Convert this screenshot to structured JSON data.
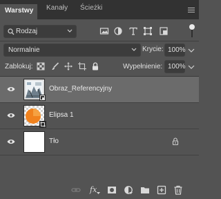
{
  "tabs": [
    {
      "label": "Warstwy",
      "active": true
    },
    {
      "label": "Kanały",
      "active": false
    },
    {
      "label": "Ścieżki",
      "active": false
    }
  ],
  "filter": {
    "kind_label": "Rodzaj",
    "icons": [
      "image-filter-icon",
      "adjustment-filter-icon",
      "type-filter-icon",
      "shape-filter-icon",
      "smart-object-filter-icon"
    ],
    "toggle_state": "on"
  },
  "blend": {
    "mode": "Normalnie",
    "opacity_label": "Krycie:",
    "opacity_value": "100%"
  },
  "lock": {
    "label": "Zablokuj:",
    "fill_label": "Wypełnienie:",
    "fill_value": "100%",
    "icons": [
      "lock-transparent-pixels-icon",
      "lock-image-pixels-icon",
      "lock-position-icon",
      "lock-artboard-icon",
      "lock-all-icon"
    ]
  },
  "layers": [
    {
      "name": "Obraz_Referencyjny",
      "visible": true,
      "selected": true,
      "thumb": "photo-thumbnail",
      "locked": false
    },
    {
      "name": "Elipsa 1",
      "visible": true,
      "selected": false,
      "thumb": "ellipse-thumbnail",
      "locked": false
    },
    {
      "name": "Tło",
      "visible": true,
      "selected": false,
      "thumb": "white-thumbnail",
      "locked": true
    }
  ],
  "footer": {
    "icons": [
      "link-layers-icon",
      "fx-icon",
      "add-mask-icon",
      "new-adjustment-icon",
      "new-group-icon",
      "new-layer-icon",
      "delete-layer-icon"
    ],
    "fx_text": "fx"
  },
  "colors": {
    "panel_bg": "#535353",
    "tabbar_bg": "#323232",
    "selected_row": "#6b6b6b",
    "ellipse_orange": "#f0821e"
  }
}
